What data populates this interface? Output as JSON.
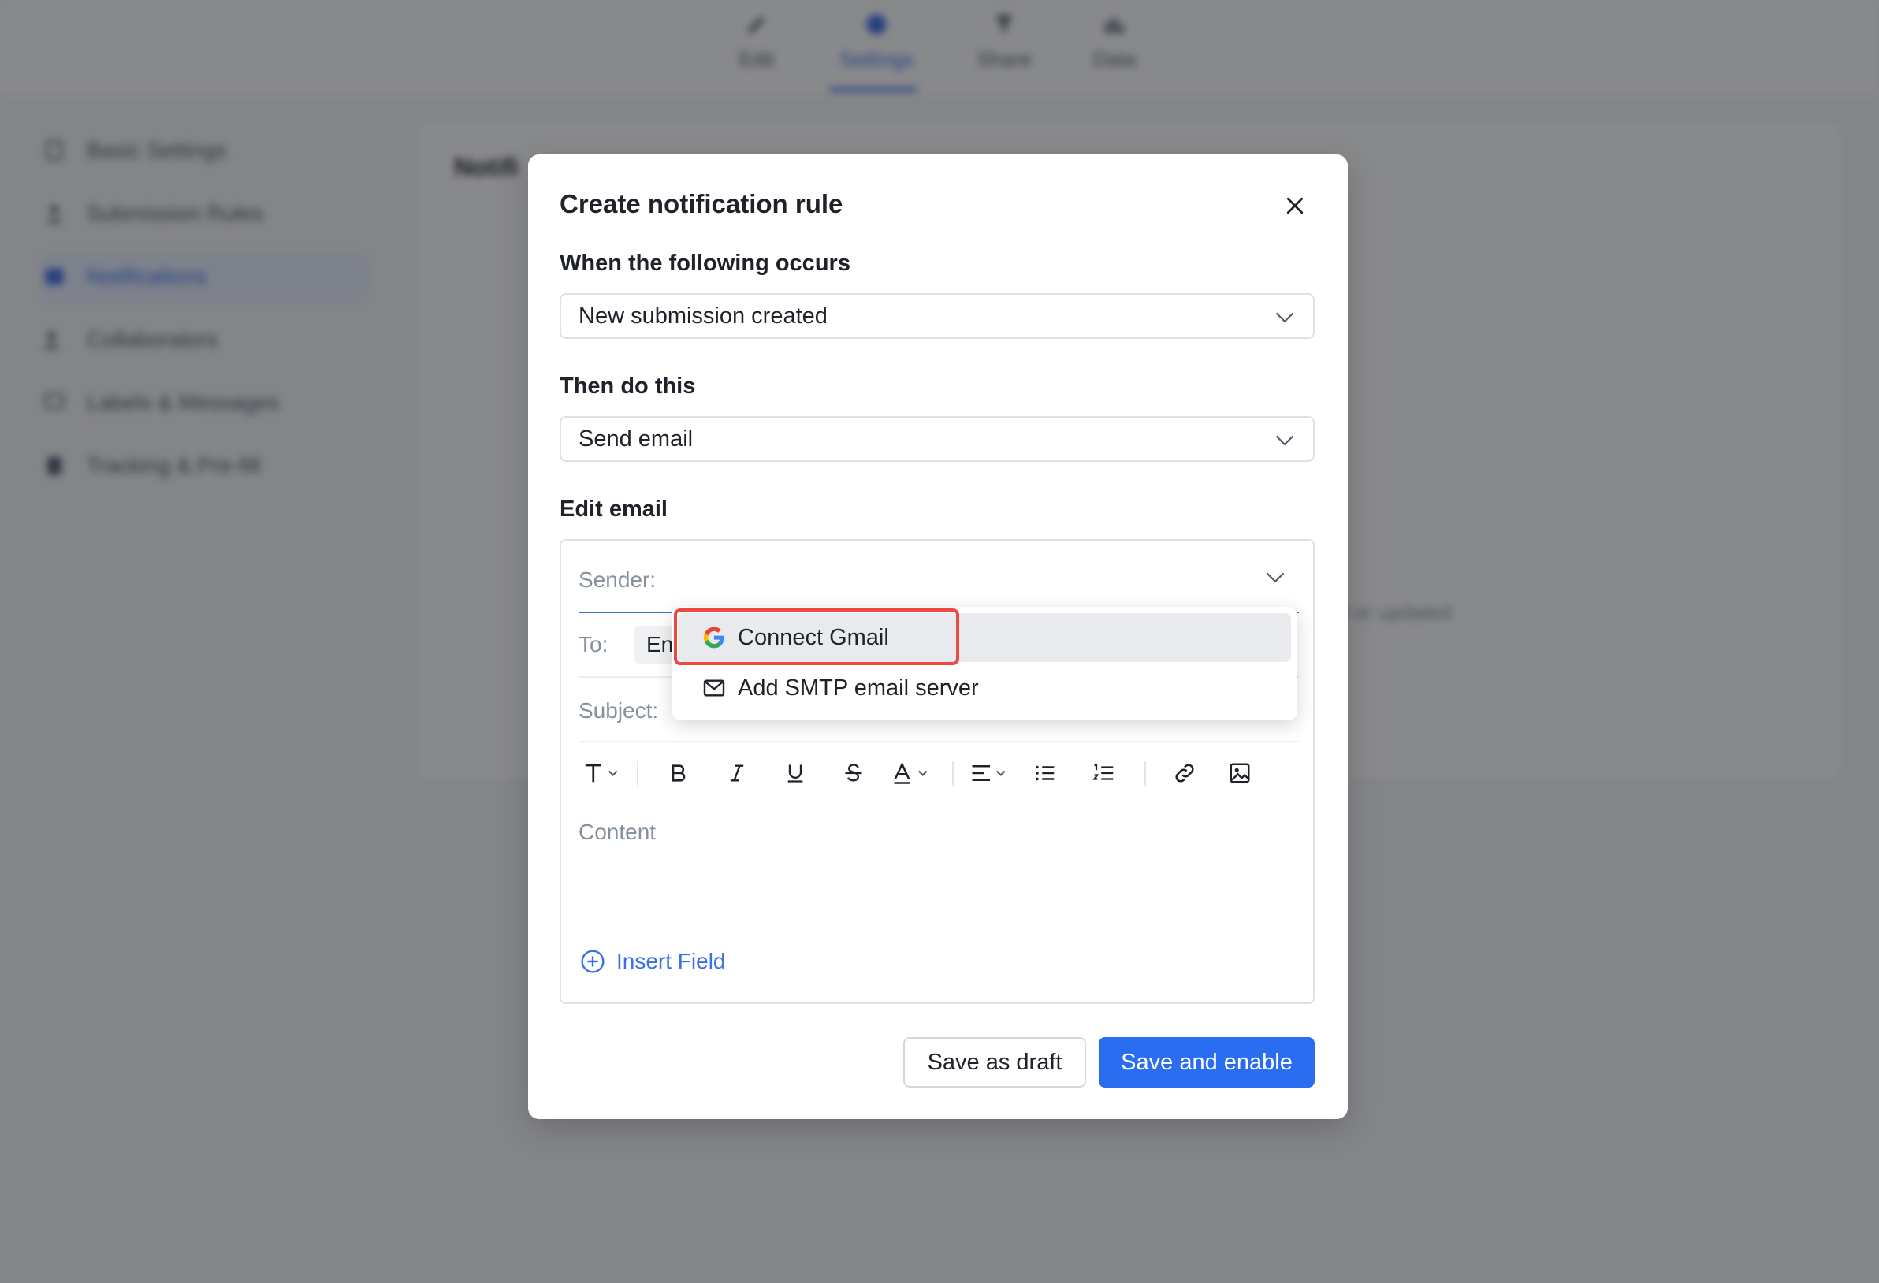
{
  "background": {
    "top_tabs": [
      {
        "label": "Edit",
        "icon": "pen-icon"
      },
      {
        "label": "Settings",
        "icon": "settings-icon"
      },
      {
        "label": "Share",
        "icon": "share-icon"
      },
      {
        "label": "Data",
        "icon": "chart-icon"
      }
    ],
    "sidebar": [
      {
        "label": "Basic Settings",
        "icon": "document-icon"
      },
      {
        "label": "Submission Rules",
        "icon": "user-icon"
      },
      {
        "label": "Notifications",
        "icon": "notification-icon"
      },
      {
        "label": "Collaborators",
        "icon": "people-icon"
      },
      {
        "label": "Labels & Messages",
        "icon": "message-icon"
      },
      {
        "label": "Tracking & Pre-fill",
        "icon": "tracking-icon"
      }
    ],
    "main_title": "Notifi",
    "main_hint": "d or updated"
  },
  "modal": {
    "title": "Create notification rule",
    "trigger_label": "When the following occurs",
    "trigger_value": "New submission created",
    "action_label": "Then do this",
    "action_value": "Send email",
    "edit_email_label": "Edit email",
    "sender_label": "Sender:",
    "to_label": "To:",
    "to_chip": "En",
    "subject_label": "Subject:",
    "content_placeholder": "Content",
    "insert_field": "Insert Field",
    "save_draft": "Save as draft",
    "save_enable": "Save and enable"
  },
  "sender_dropdown": {
    "items": [
      {
        "label": "Connect Gmail",
        "icon": "google-icon",
        "highlighted": true
      },
      {
        "label": "Add SMTP email server",
        "icon": "mail-icon",
        "highlighted": false
      }
    ]
  },
  "colors": {
    "accent": "#2a6df0",
    "highlight_border": "#ec4a3e",
    "overlay": "rgba(18,20,24,0.50)"
  }
}
